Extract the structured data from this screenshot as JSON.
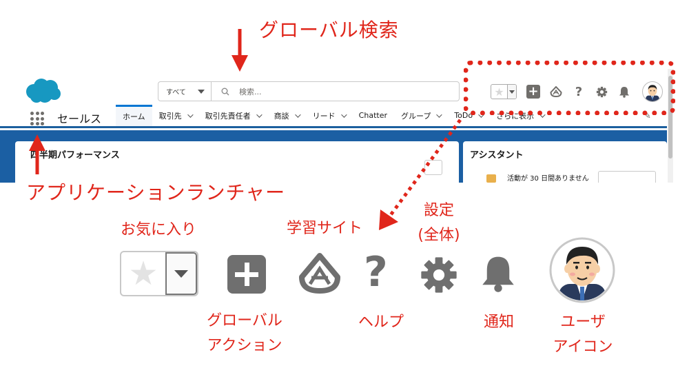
{
  "annotations": {
    "global_search": "グローバル検索",
    "app_launcher": "アプリケーションランチャー",
    "favorites": "お気に入り",
    "learning_site": "学習サイト",
    "settings_line1": "設定",
    "settings_line2": "(全体)",
    "global_action_line1": "グローバル",
    "global_action_line2": "アクション",
    "help": "ヘルプ",
    "notification": "通知",
    "user_icon_line1": "ユーザ",
    "user_icon_line2": "アイコン"
  },
  "header": {
    "scope_label": "すべて",
    "search_placeholder": "検索..."
  },
  "nav": {
    "app_name": "セールス",
    "tabs": [
      {
        "label": "ホーム"
      },
      {
        "label": "取引先"
      },
      {
        "label": "取引先責任者"
      },
      {
        "label": "商談"
      },
      {
        "label": "リード"
      },
      {
        "label": "Chatter"
      },
      {
        "label": "グループ"
      },
      {
        "label": "ToDo"
      },
      {
        "label": "さらに表示"
      }
    ]
  },
  "cards": {
    "left_title": "四半期パフォーマンス",
    "right_title": "アシスタント",
    "right_activity": "活動が 30 日間ありません"
  },
  "colors": {
    "annotation_red": "#e0261b",
    "nav_active": "#0176d3",
    "content_blue": "#1b5fa3",
    "icon_gray": "#706e6b"
  },
  "icons": [
    "salesforce-cloud-icon",
    "search-icon",
    "favorite-star-icon",
    "global-action-plus-icon",
    "trailhead-icon",
    "help-icon",
    "gear-icon",
    "bell-icon",
    "user-avatar-icon",
    "app-launcher-icon",
    "pencil-icon"
  ]
}
